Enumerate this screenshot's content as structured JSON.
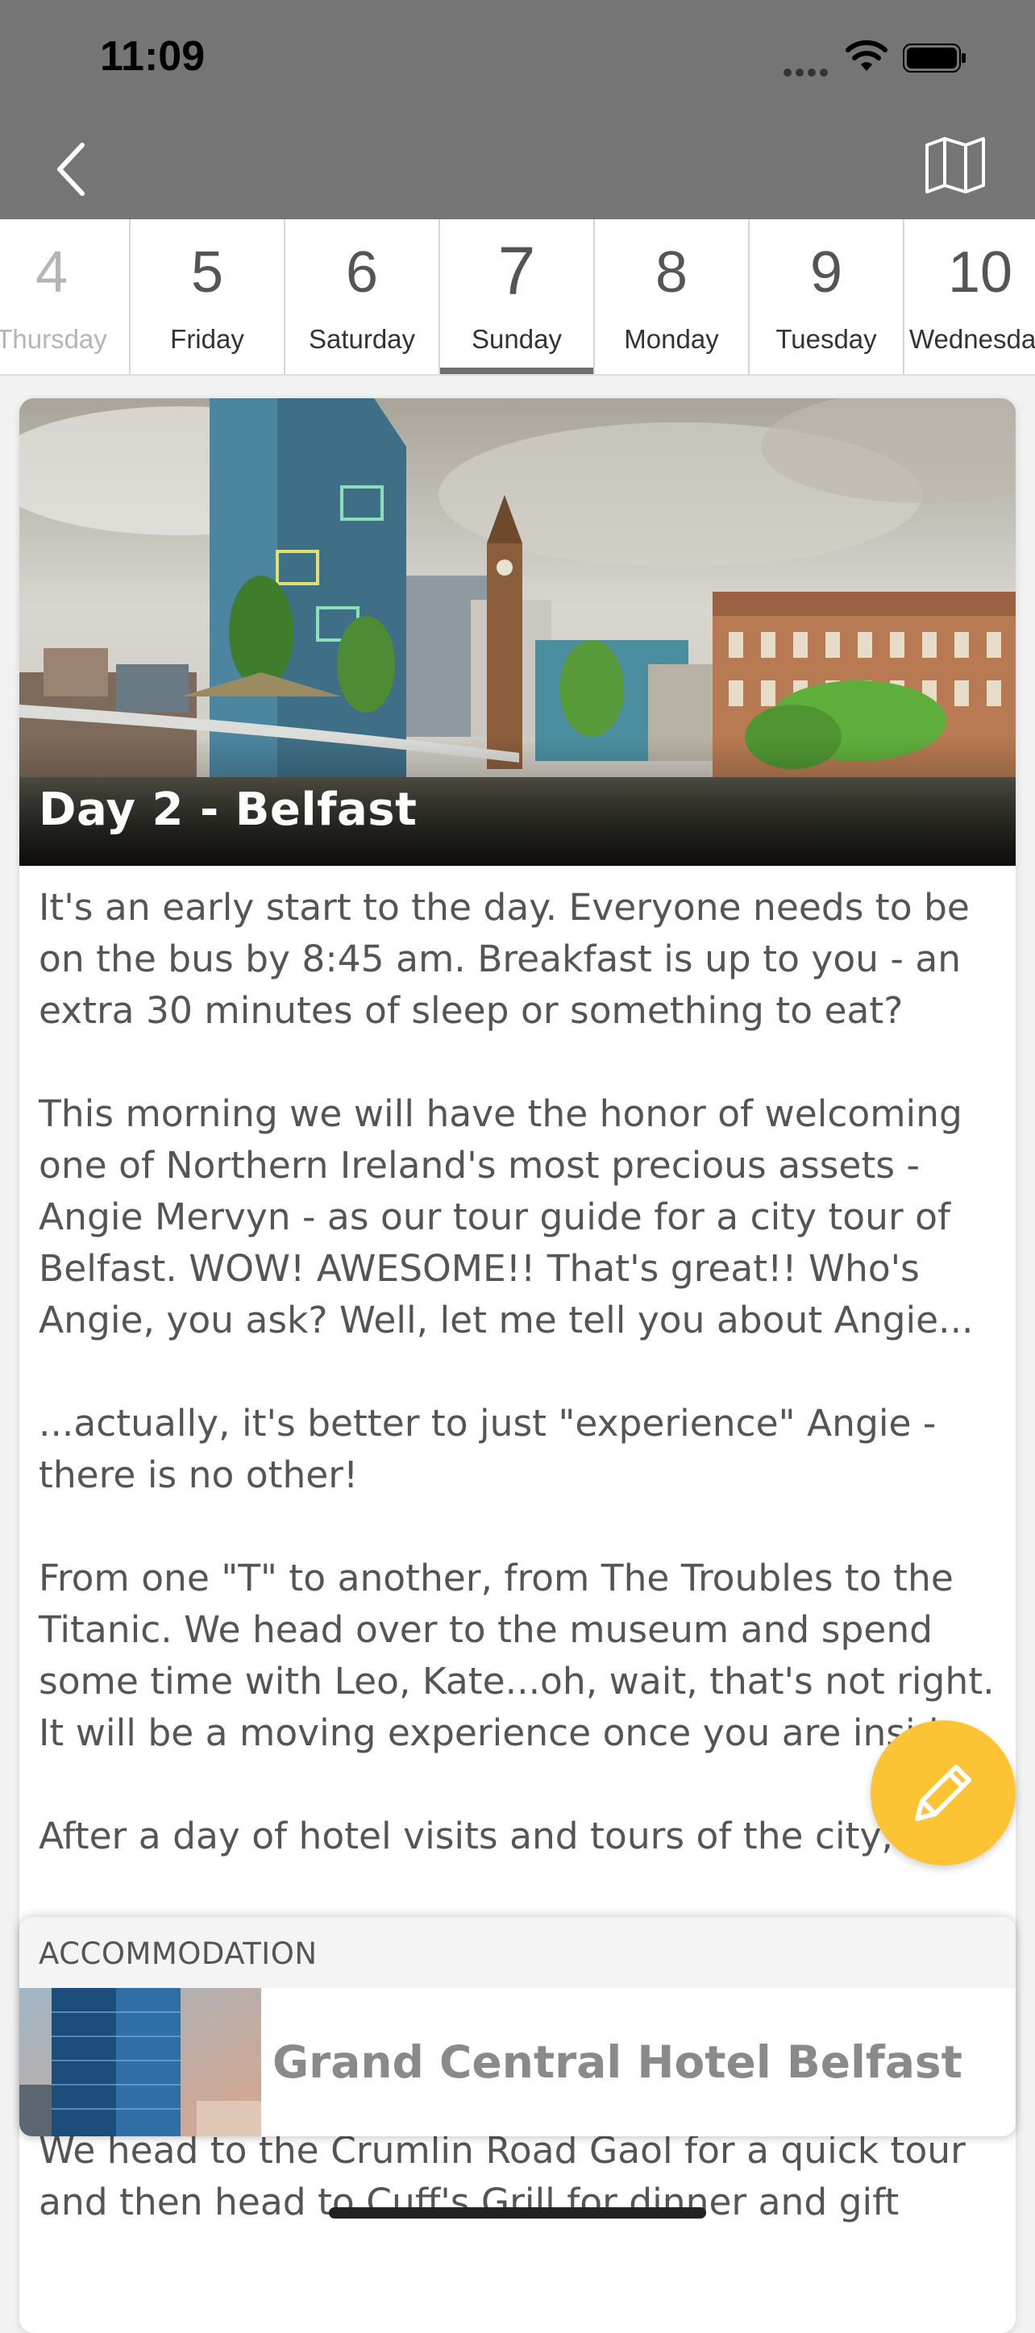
{
  "status_bar": {
    "time": "11:09"
  },
  "nav": {
    "back_icon": "chevron-left-icon",
    "map_icon": "map-icon"
  },
  "days": [
    {
      "number": "4",
      "name": "Thursday",
      "state": "faded"
    },
    {
      "number": "5",
      "name": "Friday",
      "state": "normal"
    },
    {
      "number": "6",
      "name": "Saturday",
      "state": "normal"
    },
    {
      "number": "7",
      "name": "Sunday",
      "state": "selected"
    },
    {
      "number": "8",
      "name": "Monday",
      "state": "normal"
    },
    {
      "number": "9",
      "name": "Tuesday",
      "state": "normal"
    },
    {
      "number": "10",
      "name": "Wednesday",
      "state": "normal"
    }
  ],
  "card": {
    "title": "Day 2 - Belfast",
    "paragraphs": [
      "It's an early start to the day.  Everyone needs to be on the bus by 8:45 am.  Breakfast is up to you - an extra 30 minutes of sleep or something to eat?",
      "This morning we will have the honor of welcoming one of Northern Ireland's most precious assets - Angie Mervyn - as our tour guide for a city tour of Belfast.  WOW! AWESOME!! That's great!!  Who's Angie, you ask?  Well, let me tell you about Angie...",
      "...actually, it's better to just \"experience\" Angie - there is no other!",
      "From one \"T\" to another, from The Troubles to the Titanic.  We head over to the museum and spend some time with Leo, Kate...oh, wait, that's not right.  It will be a moving experience once you are inside.",
      "After a day of hotel visits and tours of the city, it's"
    ]
  },
  "accommodation": {
    "label": "ACCOMMODATION",
    "name": "Grand Central Hotel Belfast"
  },
  "trailing_text": "We head to the Crumlin Road Gaol for a quick tour and then head to Cuff's Grill for dinner and gift",
  "fab": {
    "icon": "pencil-icon"
  },
  "colors": {
    "topbar": "#757575",
    "fab": "#fcc434",
    "selected_underline": "#6e6e6e"
  }
}
